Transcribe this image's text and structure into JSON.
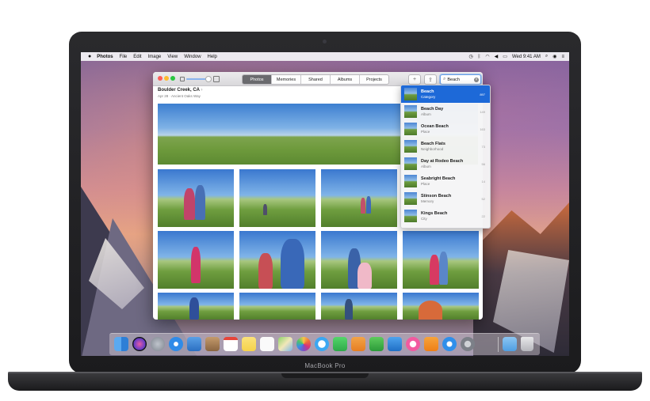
{
  "menubar": {
    "app_name": "Photos",
    "items": [
      "File",
      "Edit",
      "Image",
      "View",
      "Window",
      "Help"
    ],
    "clock": "Wed 9:41 AM"
  },
  "toolbar": {
    "tabs": [
      {
        "label": "Photos",
        "active": true
      },
      {
        "label": "Memories",
        "active": false
      },
      {
        "label": "Shared",
        "active": false
      },
      {
        "label": "Albums",
        "active": false
      },
      {
        "label": "Projects",
        "active": false
      }
    ],
    "add_label": "+",
    "share_label": "⇪",
    "search_value": "Beach"
  },
  "moment": {
    "title": "Boulder Creek, CA",
    "subtitle": "Apr 28 · Ancient Oaks Way"
  },
  "search_results": [
    {
      "name": "Beach",
      "type": "Category",
      "count": "897",
      "selected": true
    },
    {
      "name": "Beach Day",
      "type": "Album",
      "count": "149",
      "selected": false
    },
    {
      "name": "Ocean Beach",
      "type": "Place",
      "count": "163",
      "selected": false
    },
    {
      "name": "Beach Flats",
      "type": "Neighborhood",
      "count": "73",
      "selected": false
    },
    {
      "name": "Day at Rodeo Beach",
      "type": "Album",
      "count": "56",
      "selected": false
    },
    {
      "name": "Seabright Beach",
      "type": "Place",
      "count": "14",
      "selected": false
    },
    {
      "name": "Stinson Beach",
      "type": "Memory",
      "count": "52",
      "selected": false
    },
    {
      "name": "Kings Beach",
      "type": "City",
      "count": "22",
      "selected": false
    }
  ],
  "dock_apps": [
    "finder-icon",
    "siri-icon",
    "launchpad-icon",
    "safari-icon",
    "mail-icon",
    "contacts-icon",
    "calendar-icon",
    "notes-icon",
    "reminders-icon",
    "maps-icon",
    "photos-icon",
    "messages-icon",
    "facetime-icon",
    "pages-icon",
    "numbers-icon",
    "keynote-icon",
    "itunes-icon",
    "ibooks-icon",
    "app-store-icon",
    "system-preferences-icon",
    "downloads-folder-icon",
    "trash-icon"
  ],
  "device": {
    "brand": "MacBook Pro"
  }
}
